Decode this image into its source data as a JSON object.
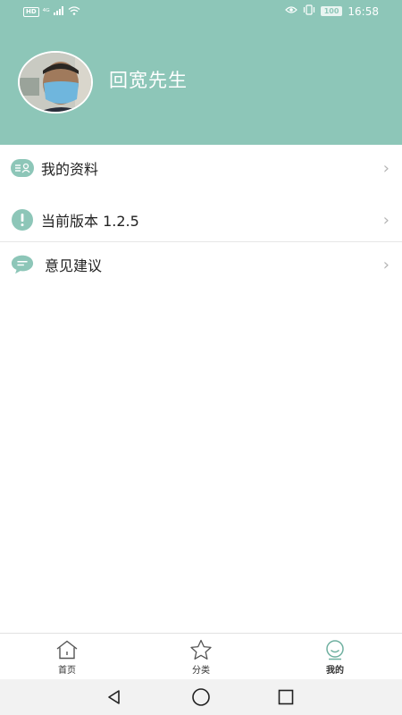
{
  "status_bar": {
    "hd_label": "HD",
    "network": "⁴ᴳ",
    "battery": "100",
    "time": "16:58"
  },
  "profile": {
    "username": "回宽先生"
  },
  "menu": [
    {
      "label": "我的资料",
      "icon": "profile-list-icon"
    },
    {
      "label": "当前版本 1.2.5",
      "icon": "exclamation-circle-icon"
    },
    {
      "label": "意见建议",
      "icon": "chat-bubble-icon"
    }
  ],
  "tabs": [
    {
      "label": "首页",
      "icon": "home-icon",
      "active": false
    },
    {
      "label": "分类",
      "icon": "star-icon",
      "active": false
    },
    {
      "label": "我的",
      "icon": "smiley-icon",
      "active": true
    }
  ],
  "colors": {
    "accent": "#8dc6b8",
    "header_bg": "#8dc6b8"
  }
}
